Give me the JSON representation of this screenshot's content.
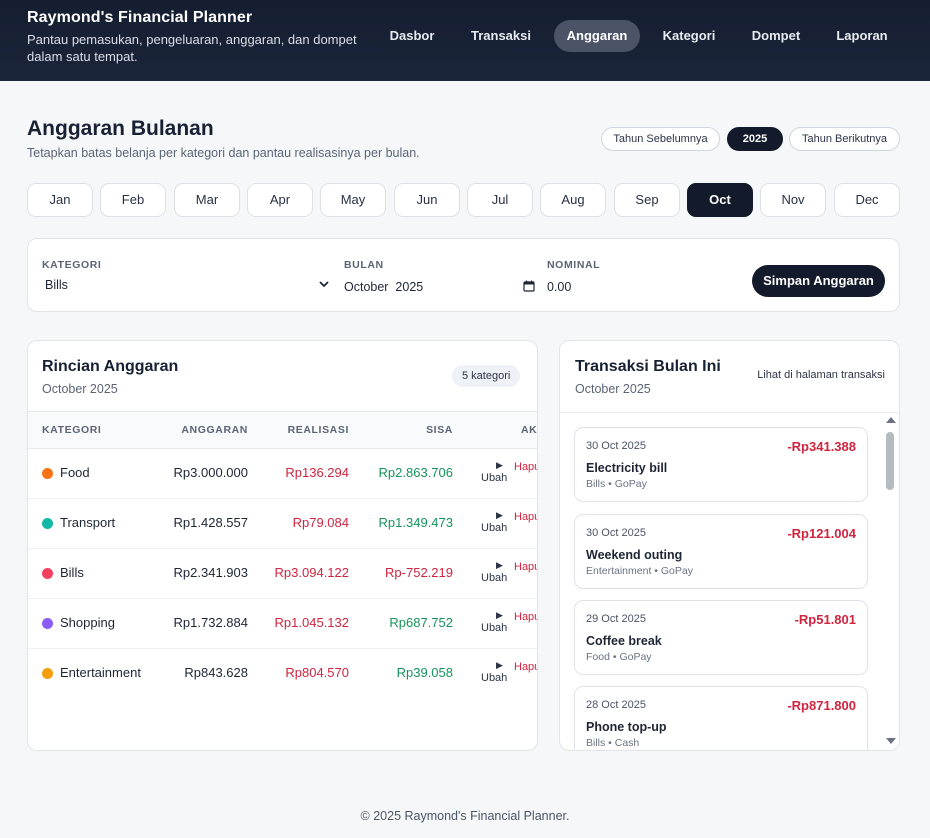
{
  "header": {
    "title": "Raymond's Financial Planner",
    "subtitle": "Pantau pemasukan, pengeluaran, anggaran, dan dompet dalam satu tempat.",
    "nav": [
      "Dasbor",
      "Transaksi",
      "Anggaran",
      "Kategori",
      "Dompet",
      "Laporan"
    ],
    "active_nav": "Anggaran"
  },
  "page": {
    "title": "Anggaran Bulanan",
    "subtitle": "Tetapkan batas belanja per kategori dan pantau realisasinya per bulan."
  },
  "year_switcher": {
    "prev_label": "Tahun Sebelumnya",
    "current": "2025",
    "next_label": "Tahun Berikutnya"
  },
  "months": [
    "Jan",
    "Feb",
    "Mar",
    "Apr",
    "May",
    "Jun",
    "Jul",
    "Aug",
    "Sep",
    "Oct",
    "Nov",
    "Dec"
  ],
  "active_month": "Oct",
  "form": {
    "category_label": "KATEGORI",
    "category_value": "Bills",
    "month_label": "BULAN",
    "month_value": "October  2025",
    "amount_label": "NOMINAL",
    "amount_value": "0.00",
    "save_label": "Simpan Anggaran"
  },
  "budget": {
    "title": "Rincian Anggaran",
    "period": "October 2025",
    "count_badge": "5 kategori",
    "columns": [
      "KATEGORI",
      "ANGGARAN",
      "REALISASI",
      "SISA",
      "AKSI"
    ],
    "edit_label": "Ubah",
    "delete_label": "Hapus",
    "rows": [
      {
        "category": "Food",
        "color": "#f97316",
        "budget": "Rp3.000.000",
        "actual": "Rp136.294",
        "remaining": "Rp2.863.706",
        "state": "pos"
      },
      {
        "category": "Transport",
        "color": "#14b8a6",
        "budget": "Rp1.428.557",
        "actual": "Rp79.084",
        "remaining": "Rp1.349.473",
        "state": "pos"
      },
      {
        "category": "Bills",
        "color": "#f43f5e",
        "budget": "Rp2.341.903",
        "actual": "Rp3.094.122",
        "remaining": "Rp-752.219",
        "state": "neg"
      },
      {
        "category": "Shopping",
        "color": "#8b5cf6",
        "budget": "Rp1.732.884",
        "actual": "Rp1.045.132",
        "remaining": "Rp687.752",
        "state": "pos"
      },
      {
        "category": "Entertainment",
        "color": "#f59e0b",
        "budget": "Rp843.628",
        "actual": "Rp804.570",
        "remaining": "Rp39.058",
        "state": "pos"
      }
    ]
  },
  "transactions": {
    "title": "Transaksi Bulan Ini",
    "period": "October 2025",
    "link_label": "Lihat di halaman transaksi",
    "items": [
      {
        "date": "30 Oct 2025",
        "amount": "-Rp341.388",
        "title": "Electricity bill",
        "meta": "Bills • GoPay"
      },
      {
        "date": "30 Oct 2025",
        "amount": "-Rp121.004",
        "title": "Weekend outing",
        "meta": "Entertainment • GoPay"
      },
      {
        "date": "29 Oct 2025",
        "amount": "-Rp51.801",
        "title": "Coffee break",
        "meta": "Food • GoPay"
      },
      {
        "date": "28 Oct 2025",
        "amount": "-Rp871.800",
        "title": "Phone top-up",
        "meta": "Bills • Cash"
      }
    ]
  },
  "footer": "© 2025 Raymond's Financial Planner."
}
